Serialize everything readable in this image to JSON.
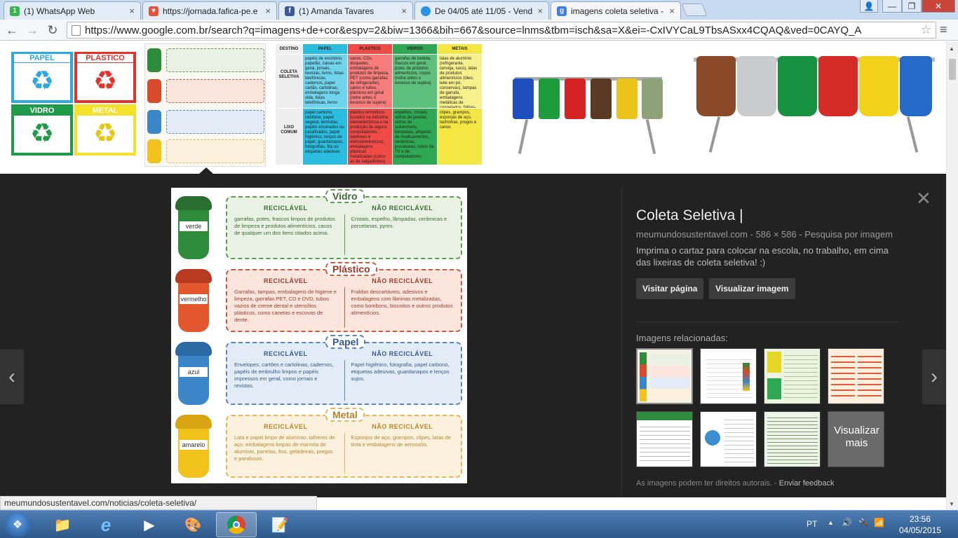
{
  "tabs": [
    {
      "label": "(1) WhatsApp Web",
      "fav": "1",
      "fav_color": "#34b74a"
    },
    {
      "label": "https://jornada.fafica-pe.e",
      "fav": "♥",
      "fav_color": "#e6513d"
    },
    {
      "label": "(1) Amanda Tavares",
      "fav": "f",
      "fav_color": "#3b5998"
    },
    {
      "label": "De 04/05 até 11/05 - Vend",
      "fav": "",
      "fav_color": "#2a8fe6"
    },
    {
      "label": "imagens coleta seletiva - I",
      "fav": "g",
      "fav_color": "#3f7ee8"
    }
  ],
  "omnibox": {
    "url": "https://www.google.com.br/search?q=imagens+de+cor&espv=2&biw=1366&bih=667&source=lnms&tbm=isch&sa=X&ei=-CxIVYCaL9TbsASxx4CQAQ&ved=0CAYQ_A"
  },
  "thumb1": {
    "papel": "PAPEL",
    "plastico": "PLÁSTICO",
    "vidro": "VIDRO",
    "metal": "METAL"
  },
  "thumb3": {
    "headers": [
      "DESTINO",
      "PAPEL",
      "PLÁSTICO",
      "VIDROS",
      "METAIS"
    ],
    "row1": [
      "COLETA SELETIVA",
      "papéis de escritório, papelão, caixas em geral, jornais, revistas, livros, listas telefônicas, cadernos, papel cartão, cartolinas, embalagens longa vida, listas telefônicas, livros",
      "sacos, CDs, disquetes, embalagens de produtos de limpeza, PET (como garrafas de refrigerante), canos e tubos, plásticos em geral (retire antes o excesso de sujeira)",
      "garrafas de bebida, frascos em geral, potes de produtos alimentícios, copos (retire antes o excesso de sujeira)",
      "latas de alumínio (refrigerante, cerveja, suco), latas de produtos alimentícios (óleo, leite em pó, conservas), tampas de garrafa, embalagens metálicas de congelados, folhas-de-flandres"
    ],
    "row2": [
      "LIXO COMUM",
      "papel carbono, celofane, papel vegetal, termofax, papéis encerados ou parafinados, papel higiênico, lenços de papel, guardanapos, fotografias, fita ou etiquetas adesivas",
      "plástico termofixos (usados na indústria eletroeletrônica e na produção de alguns computadores, telefones e eletrodomésticos), embalagens plásticas metalizadas (como as de salgadinhos)",
      "espelhos, cristais, vidros de janelas, vidros de automóveis, lâmpadas, ampolas de medicamentos, cerâmicas, porcelanas, tubos de TV e de computadores",
      "clipes, grampos, esponjas de aço, tachinhas, pregos e canos"
    ]
  },
  "poster": {
    "sections": [
      {
        "title": "Vidro",
        "bin": "verde",
        "color": "#2e8b3a",
        "bg": "#e8f1e4",
        "border": "#5f9a55",
        "recyclable": "garrafas, potes, frascos limpos de produtos de limpeza e produtos alimentícios, cacos de qualquer um dos itens citados acima.",
        "not_recyclable": "Cristais, espelho, lâmpadas, cerâmicas e porcelanas, pyrex."
      },
      {
        "title": "Plástico",
        "bin": "vermelho",
        "color": "#d94a2b",
        "bg": "#fbe5dd",
        "border": "#c95a45",
        "recyclable": "Garrafas, tampas, embalagens de higiene e limpeza, garrafas PET, CD e DVD, tubos vazios de creme dental e utensílios plásticos, como canetas e escovas de dente.",
        "not_recyclable": "Fraldas descartáveis, adesivos e embalagens com lâminas metalizadas, como bombons, biscoitos e outros produtos alimentícios."
      },
      {
        "title": "Papel",
        "bin": "azul",
        "color": "#3b86c6",
        "bg": "#e3ecf6",
        "border": "#5b84b8",
        "recyclable": "Envelopes, cartões e cartolinas, cadernos, papéis de embrulho limpos e papéis impressos em geral, como jornais e revistas.",
        "not_recyclable": "Papel higiênico, fotografia, papel carbono, etiquetas adesivas, guardanapos e lenços sujos."
      },
      {
        "title": "Metal",
        "bin": "amarelo",
        "color": "#f1c21b",
        "bg": "#fcf1dc",
        "border": "#e9b35a",
        "recyclable": "Lata e papel limpo de alumínio, talheres de aço, embalagens limpas de marmita de alumínio, panelas, fios, geladeiras, pregos e parafusos.",
        "not_recyclable": "Esponjos de aço, grampos, clipes, latas de tinta e embalagens de aerossóis."
      }
    ],
    "recyclable_label": "RECICLÁVEL",
    "not_recyclable_label": "NÃO RECICLÁVEL"
  },
  "info": {
    "title": "Coleta Seletiva |",
    "meta": "meumundosustentavel.com - 586 × 586 - Pesquisa por imagem",
    "description": "Imprima o cartaz para colocar na escola, no trabalho, em cima das lixeiras de coleta seletiva! :)",
    "visit_button": "Visitar página",
    "view_button": "Visualizar imagem",
    "related_heading": "Imagens relacionadas:",
    "more_label": "Visualizar mais",
    "copyright": "As imagens podem ter direitos autorais.",
    "feedback": "Enviar feedback"
  },
  "status_bar": "meumundosustentavel.com/noticias/coleta-seletiva/",
  "taskbar": {
    "lang": "PT",
    "time": "23:56",
    "date": "04/05/2015"
  }
}
